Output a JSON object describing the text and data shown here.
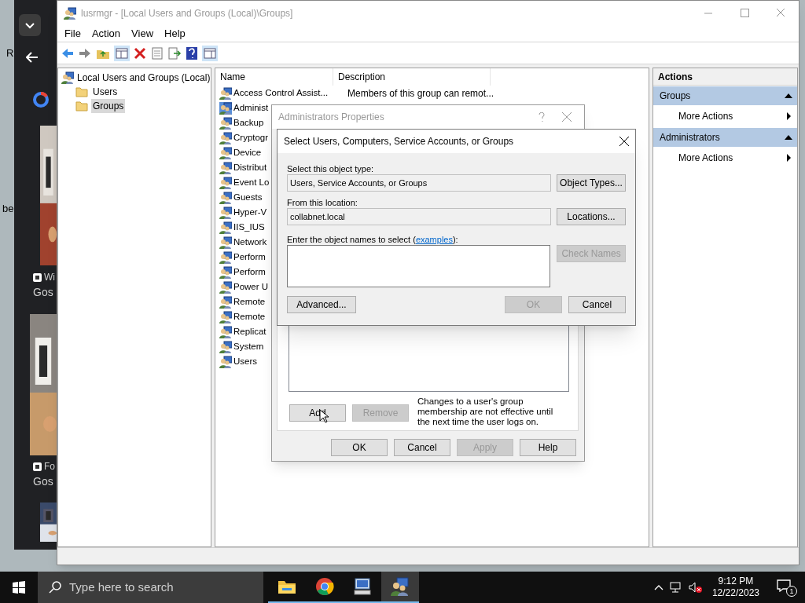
{
  "desktop": {
    "fragments": [
      "R",
      "be"
    ]
  },
  "browser": {
    "cards": [
      {
        "source": "Wi",
        "title": "Gos"
      },
      {
        "source": "Fo",
        "title": "Gos"
      }
    ]
  },
  "main_window": {
    "title": "lusrmgr - [Local Users and Groups (Local)\\Groups]",
    "menu": [
      "File",
      "Action",
      "View",
      "Help"
    ],
    "tree": {
      "label": "Local Users and Groups (Local)",
      "children": [
        {
          "label": "Users",
          "selected": false
        },
        {
          "label": "Groups",
          "selected": true
        }
      ]
    },
    "list": {
      "columns": [
        "Name",
        "Description"
      ],
      "rows": [
        {
          "name": "Access Control Assist...",
          "description": "Members of this group can remot...",
          "selected": false
        },
        {
          "name": "Administ",
          "selected": true
        },
        {
          "name": "Backup",
          "selected": false
        },
        {
          "name": "Cryptogr",
          "selected": false
        },
        {
          "name": "Device",
          "selected": false
        },
        {
          "name": "Distribut",
          "selected": false
        },
        {
          "name": "Event Lo",
          "selected": false
        },
        {
          "name": "Guests",
          "selected": false
        },
        {
          "name": "Hyper-V",
          "selected": false
        },
        {
          "name": "IIS_IUS",
          "selected": false
        },
        {
          "name": "Network",
          "selected": false
        },
        {
          "name": "Perform",
          "selected": false
        },
        {
          "name": "Perform",
          "selected": false
        },
        {
          "name": "Power U",
          "selected": false
        },
        {
          "name": "Remote",
          "selected": false
        },
        {
          "name": "Remote",
          "selected": false
        },
        {
          "name": "Replicat",
          "selected": false
        },
        {
          "name": "System",
          "selected": false
        },
        {
          "name": "Users",
          "selected": false
        }
      ]
    },
    "actions": {
      "title": "Actions",
      "sections": [
        {
          "title": "Groups",
          "items": [
            "More Actions"
          ]
        },
        {
          "title": "Administrators",
          "items": [
            "More Actions"
          ]
        }
      ]
    }
  },
  "properties_dialog": {
    "title": "Administrators Properties",
    "note": "Changes to a user's group membership are not effective until the next time the user logs on.",
    "member_buttons": [
      {
        "label": "Add",
        "disabled": false
      },
      {
        "label": "Remove",
        "disabled": true
      }
    ],
    "buttons": [
      {
        "label": "OK",
        "disabled": false
      },
      {
        "label": "Cancel",
        "disabled": false
      },
      {
        "label": "Apply",
        "disabled": true
      },
      {
        "label": "Help",
        "disabled": false
      }
    ]
  },
  "select_dialog": {
    "title": "Select Users, Computers, Service Accounts, or Groups",
    "fields": [
      {
        "label": "Select this object type:",
        "value": "Users, Service Accounts, or Groups",
        "button": "Object Types..."
      },
      {
        "label": "From this location:",
        "value": "collabnet.local",
        "button": "Locations..."
      }
    ],
    "names": {
      "label_before": "Enter the object names to select (",
      "link": "examples",
      "label_after": "):",
      "button": {
        "label": "Check Names",
        "disabled": true
      }
    },
    "buttons": [
      {
        "label": "Advanced...",
        "disabled": false
      },
      {
        "label": "OK",
        "disabled": true
      },
      {
        "label": "Cancel",
        "disabled": false
      }
    ]
  },
  "taskbar": {
    "search_placeholder": "Type here to search",
    "apps": [
      {
        "kind": "folder",
        "selected": false
      },
      {
        "kind": "chrome",
        "selected": false
      },
      {
        "kind": "computer",
        "selected": false
      },
      {
        "kind": "users",
        "selected": true
      }
    ],
    "time": "9:12 PM",
    "date": "12/22/2023",
    "notifications": "1"
  }
}
